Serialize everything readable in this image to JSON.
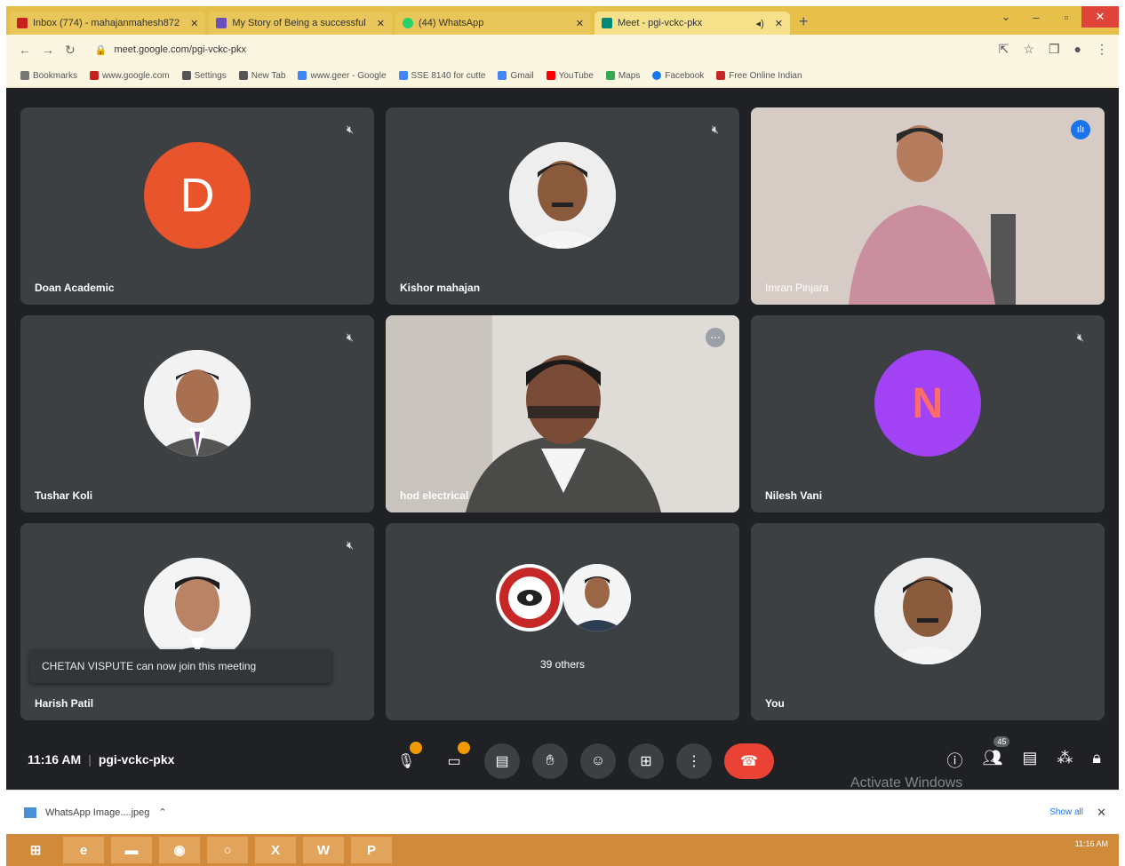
{
  "browser": {
    "tabs": [
      {
        "label": "Inbox (774) - mahajanmahesh872",
        "color": "#c5221f"
      },
      {
        "label": "My Story of Being a successful",
        "color": "#6b4fbb"
      },
      {
        "label": "(44) WhatsApp",
        "color": "#25d366"
      },
      {
        "label": "Meet - pgi-vckc-pkx",
        "color": "#00897b",
        "active": true
      }
    ],
    "new_tab": "+",
    "url": "meet.google.com/pgi-vckc-pkx",
    "bookmarks": [
      {
        "label": "Bookmarks",
        "color": "#777"
      },
      {
        "label": "www.google.com",
        "color": "#c5221f"
      },
      {
        "label": "Settings",
        "color": "#555"
      },
      {
        "label": "New Tab",
        "color": "#555"
      },
      {
        "label": "www.geer - Google",
        "color": "#4285f4"
      },
      {
        "label": "SSE 8140 for cutte",
        "color": "#4285f4"
      },
      {
        "label": "Gmail",
        "color": "#4285f4"
      },
      {
        "label": "YouTube",
        "color": "#ff0000"
      },
      {
        "label": "Maps",
        "color": "#34a853"
      },
      {
        "label": "Facebook",
        "color": "#1877f2"
      },
      {
        "label": "Free Online Indian",
        "color": "#c62828"
      }
    ]
  },
  "meet": {
    "tiles": [
      {
        "name": "Doan Academic",
        "avatar": "D"
      },
      {
        "name": "Kishor mahajan"
      },
      {
        "name": "Imran Pinjara"
      },
      {
        "name": "Tushar Koli"
      },
      {
        "name": "hod electrical"
      },
      {
        "name": "Nilesh Vani",
        "avatar": "N"
      },
      {
        "name": "Harish Patil"
      },
      {
        "name": "39 others"
      },
      {
        "name": "You"
      }
    ],
    "toast": "CHETAN VISPUTE can now join this meeting",
    "time": "11:16 AM",
    "code": "pgi-vckc-pkx",
    "people_count": "45",
    "activate_text": "Activate Windows"
  },
  "downloads": {
    "file": "WhatsApp Image....jpeg",
    "show_all": "Show all"
  },
  "taskbar": {
    "tray_time": "11:16 AM"
  },
  "colors": {
    "meet_bg": "#202124",
    "tile_bg": "#3c4043",
    "end_call": "#ea4335",
    "avatar_d": "#e8542c",
    "avatar_n": "#a142f4"
  }
}
